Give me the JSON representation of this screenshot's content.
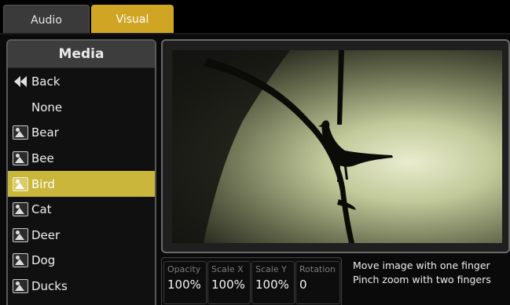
{
  "tabs": [
    {
      "label": "Audio",
      "active": false
    },
    {
      "label": "Visual",
      "active": true
    }
  ],
  "media": {
    "title": "Media",
    "items": [
      {
        "label": "Back",
        "icon": "back-icon"
      },
      {
        "label": "None",
        "icon": ""
      },
      {
        "label": "Bear",
        "icon": "image-icon"
      },
      {
        "label": "Bee",
        "icon": "image-icon"
      },
      {
        "label": "Bird",
        "icon": "image-icon",
        "selected": true
      },
      {
        "label": "Cat",
        "icon": "image-icon"
      },
      {
        "label": "Deer",
        "icon": "image-icon"
      },
      {
        "label": "Dog",
        "icon": "image-icon"
      },
      {
        "label": "Ducks",
        "icon": "image-icon"
      }
    ]
  },
  "params": {
    "opacity": {
      "label": "Opacity",
      "value": "100%"
    },
    "scale_x": {
      "label": "Scale X",
      "value": "100%"
    },
    "scale_y": {
      "label": "Scale Y",
      "value": "100%"
    },
    "rotation": {
      "label": "Rotation",
      "value": "0"
    }
  },
  "hints": {
    "line1": "Move image with one finger",
    "line2": "Pinch zoom with two fingers"
  },
  "colors": {
    "accent_tab": "#d0a524",
    "selected_row": "#c9b63a"
  }
}
